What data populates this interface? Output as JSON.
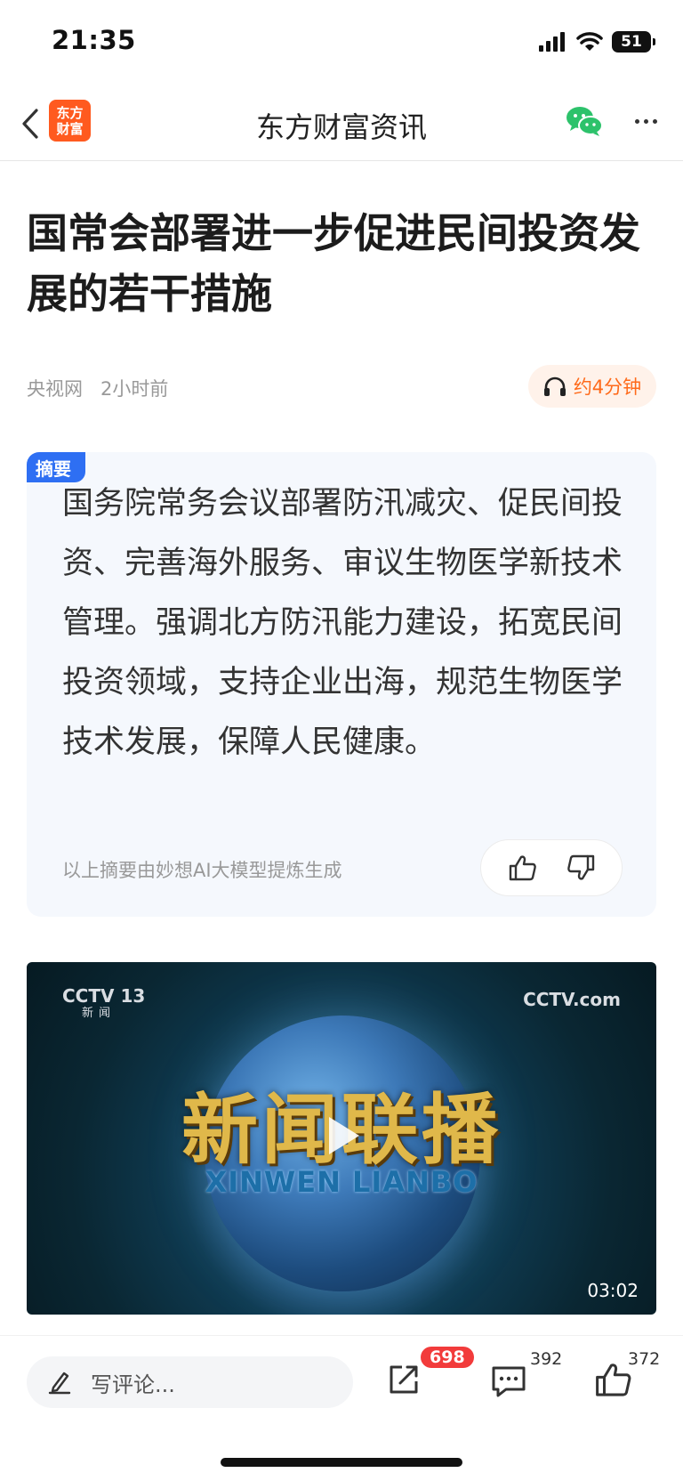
{
  "status_bar": {
    "time": "21:35",
    "battery": "51"
  },
  "nav": {
    "app_logo_line1": "东方",
    "app_logo_line2": "财富",
    "title": "东方财富资讯"
  },
  "article": {
    "headline": "国常会部署进一步促进民间投资发展的若干措施",
    "source": "央视网",
    "time_ago": "2小时前",
    "read_time": "约4分钟"
  },
  "summary": {
    "tag": "摘要",
    "text": "国务院常务会议部署防汛减灾、促民间投资、完善海外服务、审议生物医学新技术管理。强调北方防汛能力建设，拓宽民间投资领域，支持企业出海，规范生物医学技术发展，保障人民健康。",
    "note": "以上摘要由妙想AI大模型提炼生成"
  },
  "video": {
    "channel_logo": "CCTV 13",
    "channel_sub": "新闻",
    "site_logo": "CCTV.com",
    "program_title_cn": "新闻联播",
    "program_title_en": "XINWEN LIANBO",
    "duration": "03:02"
  },
  "bottom_bar": {
    "comment_placeholder": "写评论...",
    "share_count": "698",
    "comment_count": "392",
    "like_count": "372"
  },
  "colors": {
    "accent": "#ff6a1a",
    "summary_tag": "#2e6ff3",
    "badge": "#f23b3b",
    "wechat": "#2dc26b"
  },
  "icons": [
    "back-icon",
    "wechat-icon",
    "more-icon",
    "headphones-icon",
    "thumbs-up-icon",
    "thumbs-down-icon",
    "play-icon",
    "pencil-icon",
    "share-icon",
    "comment-icon",
    "like-icon"
  ]
}
